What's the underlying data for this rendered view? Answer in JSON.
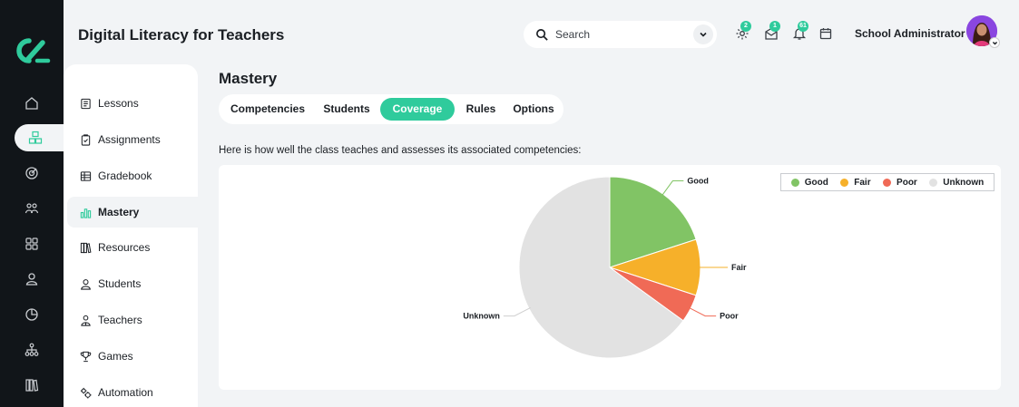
{
  "app": {
    "title": "Digital Literacy for Teachers"
  },
  "search": {
    "placeholder": "Search"
  },
  "header": {
    "badges": {
      "settings": "2",
      "messages": "1",
      "notifications": "61"
    },
    "user_name": "School Administrator"
  },
  "rail": {
    "icons": [
      "home-icon",
      "cubes-icon",
      "target-icon",
      "people-icon",
      "grid-icon",
      "person-icon",
      "chart-pie-icon",
      "hierarchy-icon",
      "books-icon"
    ],
    "active_index": 1
  },
  "subnav": {
    "items": [
      {
        "label": "Lessons",
        "icon": "document-icon"
      },
      {
        "label": "Assignments",
        "icon": "clipboard-icon"
      },
      {
        "label": "Gradebook",
        "icon": "table-icon"
      },
      {
        "label": "Mastery",
        "icon": "bar-chart-icon"
      },
      {
        "label": "Resources",
        "icon": "books-icon"
      },
      {
        "label": "Students",
        "icon": "person-icon"
      },
      {
        "label": "Teachers",
        "icon": "teacher-icon"
      },
      {
        "label": "Games",
        "icon": "trophy-icon"
      },
      {
        "label": "Automation",
        "icon": "gears-icon"
      }
    ],
    "active_index": 3
  },
  "page": {
    "title": "Mastery",
    "tabs": [
      "Competencies",
      "Students",
      "Coverage",
      "Rules",
      "Options"
    ],
    "active_tab": "Coverage",
    "intro": "Here is how well the class teaches and assesses its associated competencies:"
  },
  "colors": {
    "accent": "#2fcb9c",
    "good": "#81c465",
    "fair": "#f6b02a",
    "poor": "#f06a56",
    "unknown": "#e2e2e2"
  },
  "chart_data": {
    "type": "pie",
    "categories": [
      "Good",
      "Fair",
      "Poor",
      "Unknown"
    ],
    "values": [
      20,
      10,
      5,
      65
    ],
    "legend": [
      "Good",
      "Fair",
      "Poor",
      "Unknown"
    ],
    "legend_position": "top-right"
  }
}
